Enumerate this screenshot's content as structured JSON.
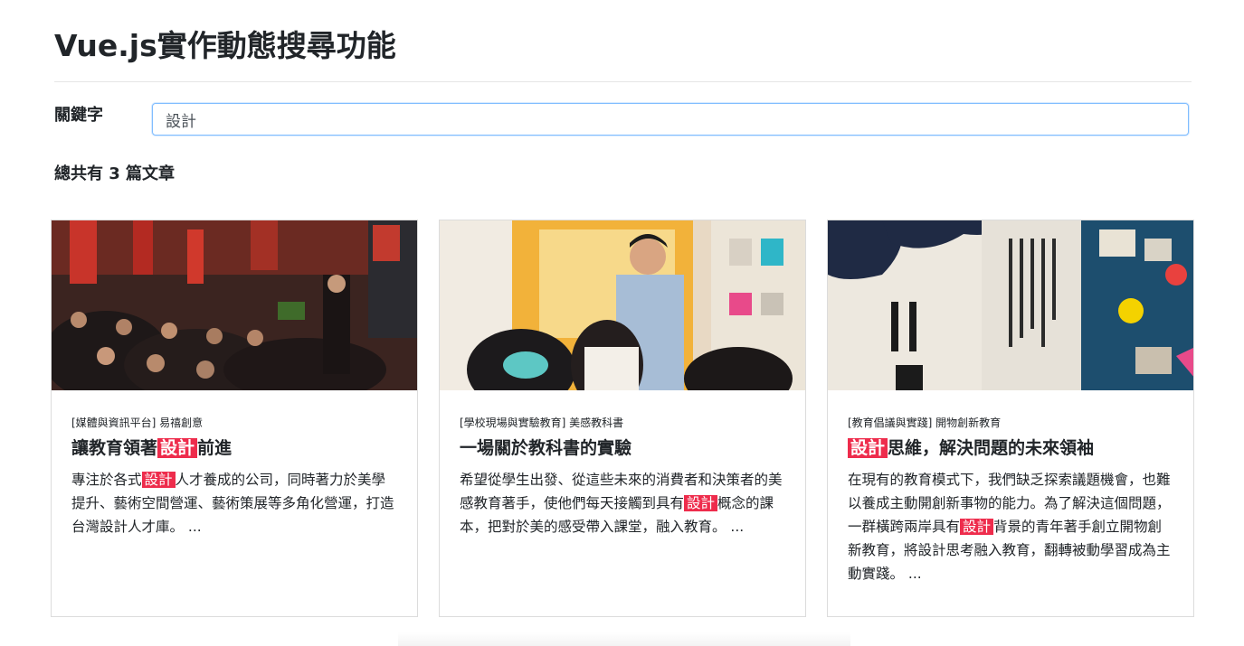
{
  "page": {
    "title": "Vue.js實作動態搜尋功能"
  },
  "search": {
    "label": "關鍵字",
    "value": "設計",
    "placeholder": ""
  },
  "results": {
    "count_text": "總共有 3 篇文章"
  },
  "articles": [
    {
      "category": "[媒體與資訊平台] 易禧創意",
      "title_parts": [
        "讓教育領著",
        "設計",
        "前進"
      ],
      "excerpt_parts": [
        "專注於各式",
        "設計",
        "人才養成的公司，同時著力於美學提升、藝術空間營運、藝術策展等多角化營運，打造台灣設計人才庫。 ..."
      ]
    },
    {
      "category": "[學校現場與實驗教育] 美感教科書",
      "title_parts": [
        "一場關於教科書的實驗",
        "",
        ""
      ],
      "excerpt_parts": [
        "希望從學生出發、從這些未來的消費者和決策者的美感教育著手，使他們每天接觸到具有",
        "設計",
        "概念的課本，把對於美的感受帶入課堂，融入教育。 ..."
      ]
    },
    {
      "category": "[教育倡議與實踐] 開物創新教育",
      "title_parts": [
        "",
        "設計",
        "思維，解決問題的未來領袖"
      ],
      "excerpt_parts": [
        "在現有的教育模式下，我們缺乏探索議題機會，也難以養成主動開創新事物的能力。為了解決這個問題，一群橫跨兩岸具有",
        "設計",
        "背景的青年著手創立開物創新教育，將設計思考融入教育，翻轉被動學習成為主動實踐。 ..."
      ]
    }
  ],
  "colors": {
    "highlight": "#ee2c4c",
    "input_focus_border": "#80bdff"
  }
}
